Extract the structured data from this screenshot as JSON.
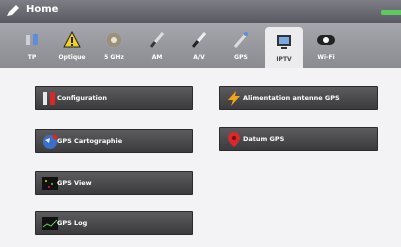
{
  "window": {
    "title": "Home"
  },
  "tabs": [
    {
      "label": "TP",
      "icon": "tp-icon"
    },
    {
      "label": "Optique",
      "icon": "optics-warning-icon"
    },
    {
      "label": "5 GHz",
      "icon": "5ghz-connector-icon"
    },
    {
      "label": "AM",
      "icon": "am-probe-icon"
    },
    {
      "label": "A/V",
      "icon": "av-probe-icon"
    },
    {
      "label": "GPS",
      "icon": "gps-probe-icon",
      "active": true
    },
    {
      "label": "IPTV",
      "icon": "iptv-monitor-icon"
    },
    {
      "label": "Wi-Fi",
      "icon": "wifi-icon"
    }
  ],
  "buttons": {
    "configuration": "Configuration",
    "gps_cartographie": "GPS Cartographie",
    "gps_view": "GPS View",
    "gps_log": "GPS Log",
    "alimentation": "Alimentation antenne GPS",
    "datum": "Datum GPS"
  },
  "colors": {
    "button_bg": "#4a4a4c",
    "content_bg": "#f3f3f6",
    "titlebar_bg": "#6a6b72",
    "battery": "#5ec95e"
  }
}
